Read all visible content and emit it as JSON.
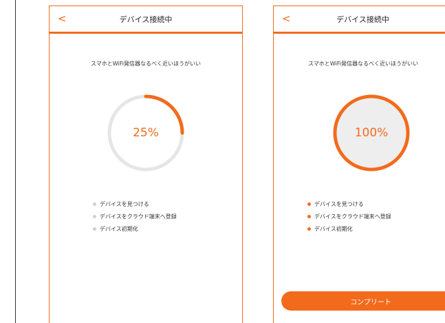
{
  "screens": [
    {
      "header": {
        "back_icon": "chevron-left-icon",
        "back_glyph": "<",
        "title": "デバイス接続中"
      },
      "hint": "スマホとWiFi発信器なるべく近いほうがいい",
      "progress": {
        "label": "25%",
        "value": 0.25
      },
      "steps": [
        {
          "label": "デバイスを見つける",
          "state": "pending"
        },
        {
          "label": "デバイスをクラウド端末へ登録",
          "state": "pending"
        },
        {
          "label": "デバイス初期化",
          "state": "pending"
        }
      ]
    },
    {
      "header": {
        "back_icon": "chevron-left-icon",
        "back_glyph": "<",
        "title": "デバイス接続中"
      },
      "hint": "スマホとWiFi発信器なるべく近いほうがいい",
      "progress": {
        "label": "100%",
        "value": 1.0
      },
      "steps": [
        {
          "label": "デバイスを見つける",
          "state": "done"
        },
        {
          "label": "デバイスをクラウド端末へ登録",
          "state": "done"
        },
        {
          "label": "デバイス初期化",
          "state": "done"
        }
      ],
      "complete_button": "コンプリート"
    }
  ],
  "colors": {
    "accent": "#f26b1d",
    "track": "#e6e6e6",
    "pending_dot": "#cfcfcf",
    "complete_fill": "#eeeeee"
  }
}
